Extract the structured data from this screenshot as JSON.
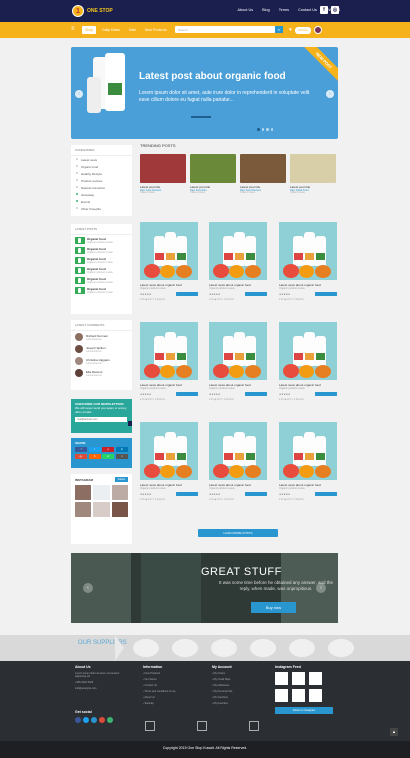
{
  "header": {
    "logo_text": "ONE STOP",
    "nav": [
      "About Us",
      "Blog",
      "Terms",
      "Contact Us",
      "KW C$$"
    ],
    "social": [
      "f",
      "ig"
    ]
  },
  "navbar": {
    "items": [
      "Shop",
      "Daily Deals",
      "Sale",
      "New Products"
    ],
    "search_placeholder": "Search",
    "cart_label": "0 Items"
  },
  "hero": {
    "ribbon": "NEW POST",
    "title": "Latest post about organic food",
    "text": "Lorem ipsum dolor sit amet, aute irure dolor in reprehenderit in voluptate velit esse cillum dolore eu fugiat nulla pariatur..."
  },
  "sidebar": {
    "categories_title": "CATEGORIES",
    "categories": [
      "Latest news",
      "Organic food",
      "Healthy lifestyle",
      "Product reviews",
      "Natural cosmetics",
      "Giveaway",
      "Events",
      "Other thoughts"
    ],
    "latest_title": "LATEST POSTS",
    "latest_posts": [
      {
        "title": "Organic food",
        "sub": "Organic product review"
      },
      {
        "title": "Organic food",
        "sub": "Organic product review"
      },
      {
        "title": "Organic food",
        "sub": "Organic product review"
      },
      {
        "title": "Organic food",
        "sub": "Organic product review"
      },
      {
        "title": "Organic food",
        "sub": "Organic product review"
      },
      {
        "title": "Organic food",
        "sub": "Organic product review"
      }
    ],
    "comments_title": "LATEST COMMENTS",
    "comments": [
      {
        "name": "Richard Norman",
        "sub": "commented on"
      },
      {
        "name": "Joseph Spilton",
        "sub": "commented on"
      },
      {
        "name": "Christina Higgans",
        "sub": "commented on"
      },
      {
        "name": "Ella Reuters",
        "sub": "commented on"
      }
    ],
    "newsletter_title": "SUBSCRIBE OUR NEWSLETTERS",
    "newsletter_sub": "We will never send you spam or annoy other emails",
    "newsletter_placeholder": "mail@domain.com",
    "share_title": "SHARE",
    "share_buttons": [
      "f",
      "t",
      "p",
      "in",
      "g+",
      "b",
      "w",
      "v"
    ],
    "instagram_title": "INSTAGRAM",
    "instagram_follow": "Follow"
  },
  "trending": {
    "title": "TRENDING POSTS",
    "items": [
      {
        "title": "Latest post title",
        "cat": "Raw Juice Recipes",
        "meta": "0 likes  0  views"
      },
      {
        "title": "Latest post title",
        "cat": "Raw Food Diet",
        "meta": "0 likes  0  views"
      },
      {
        "title": "Latest post title",
        "cat": "Raw Food Recipes",
        "meta": "0 likes  0  views"
      },
      {
        "title": "Latest post title",
        "cat": "Raw Salad Food",
        "meta": "0 likes  0  views"
      }
    ]
  },
  "grid": {
    "cards": [
      {
        "title": "Latest news about organic food",
        "sub": "Organic product review"
      },
      {
        "title": "Latest news about organic food",
        "sub": "Organic product review"
      },
      {
        "title": "Latest news about organic food",
        "sub": "Organic product review"
      },
      {
        "title": "Latest news about organic food",
        "sub": "Organic product review"
      },
      {
        "title": "Latest news about organic food",
        "sub": "Organic product review"
      },
      {
        "title": "Latest news about organic food",
        "sub": "Organic product review"
      },
      {
        "title": "Latest news about organic food",
        "sub": "Organic product review"
      },
      {
        "title": "Latest news about organic food",
        "sub": "Organic product review"
      },
      {
        "title": "Latest news about organic food",
        "sub": "Organic product review"
      }
    ],
    "meta": "♥ 46   ◉ 144   ✎ 3 Reports",
    "load_more": "LOAD MORE POSTS"
  },
  "banner": {
    "title": "GREAT STUFF",
    "text": "It was some time before he obtained any answer, and the reply, when made, was unpropitious.",
    "button": "Buy now"
  },
  "suppliers": {
    "title": "OUR SUPPLIERS"
  },
  "footer": {
    "about_title": "About Us",
    "about_text": "Lorem ipsum dolor sit amet, consectetur adipiscing elit",
    "phone": "+965 2222 3333",
    "email": "info@example.com",
    "social_title": "Get social",
    "info_title": "Information",
    "info_links": [
      "New Products",
      "Our Stores",
      "Contact Us",
      "Terms and conditions of use",
      "About Us",
      "Sitemap"
    ],
    "account_title": "My Account",
    "account_links": [
      "My Orders",
      "My Credit Slips",
      "My Addresses",
      "My Personal Info",
      "My Vouchers",
      "My Favorites"
    ],
    "feed_title": "Instagram Feed",
    "feed_button": "Follow on Instagram",
    "copyright": "Copyright 2015 One Stop Kuwait. All Rights Reserved."
  },
  "colors": {
    "navy": "#1b1f4e",
    "yellow": "#f5b21a",
    "blue": "#2a96cf",
    "teal": "#2aa79b"
  }
}
